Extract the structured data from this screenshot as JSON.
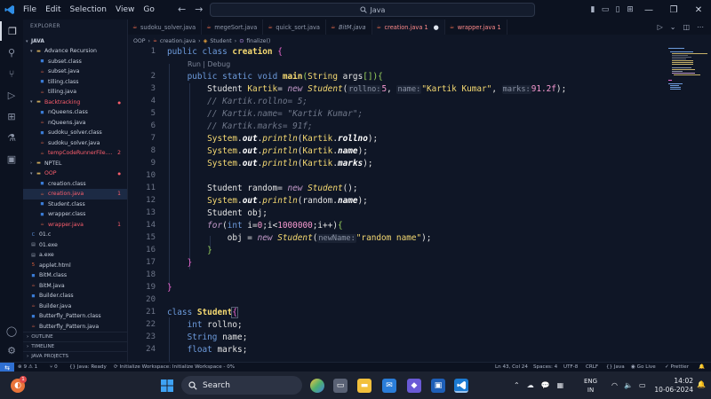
{
  "titlebar": {
    "menu": [
      "File",
      "Edit",
      "Selection",
      "View",
      "Go"
    ],
    "search": "Java"
  },
  "explorer": {
    "header": "EXPLORER",
    "root": "JAVA",
    "items": [
      {
        "label": "Advance Recursion",
        "type": "folder",
        "depth": 1,
        "open": true
      },
      {
        "label": "subset.class",
        "type": "class",
        "depth": 2
      },
      {
        "label": "subset.java",
        "type": "java",
        "depth": 2
      },
      {
        "label": "tilling.class",
        "type": "class",
        "depth": 2
      },
      {
        "label": "tilling.java",
        "type": "java",
        "depth": 2
      },
      {
        "label": "Backtracking",
        "type": "folder",
        "depth": 1,
        "open": true,
        "color": "#ff5f6d"
      },
      {
        "label": "nQueens.class",
        "type": "class",
        "depth": 2
      },
      {
        "label": "nQueens.java",
        "type": "java",
        "depth": 2
      },
      {
        "label": "sudoku_solver.class",
        "type": "class",
        "depth": 2
      },
      {
        "label": "sudoku_solver.java",
        "type": "java",
        "depth": 2
      },
      {
        "label": "tempCodeRunnerFile....",
        "type": "java",
        "depth": 2,
        "color": "#ff5f6d",
        "badge": "2"
      },
      {
        "label": "NPTEL",
        "type": "folder",
        "depth": 1,
        "open": false
      },
      {
        "label": "OOP",
        "type": "folder",
        "depth": 1,
        "open": true,
        "color": "#ff5f6d"
      },
      {
        "label": "creation.class",
        "type": "class",
        "depth": 2
      },
      {
        "label": "creation.java",
        "type": "java",
        "depth": 2,
        "color": "#ff5f6d",
        "badge": "1",
        "selected": true
      },
      {
        "label": "Student.class",
        "type": "class",
        "depth": 2
      },
      {
        "label": "wrapper.class",
        "type": "class",
        "depth": 2
      },
      {
        "label": "wrapper.java",
        "type": "java",
        "depth": 2,
        "color": "#ff5f6d",
        "badge": "1"
      },
      {
        "label": "01.c",
        "type": "c",
        "depth": 1
      },
      {
        "label": "01.exe",
        "type": "exe",
        "depth": 1
      },
      {
        "label": "a.exe",
        "type": "exe",
        "depth": 1
      },
      {
        "label": "applet.html",
        "type": "html",
        "depth": 1
      },
      {
        "label": "BitM.class",
        "type": "class",
        "depth": 1
      },
      {
        "label": "BitM.java",
        "type": "java",
        "depth": 1
      },
      {
        "label": "Builder.class",
        "type": "class",
        "depth": 1
      },
      {
        "label": "Builder.java",
        "type": "java",
        "depth": 1
      },
      {
        "label": "Butterfly_Pattern.class",
        "type": "class",
        "depth": 1
      },
      {
        "label": "Butterfly_Pattern.java",
        "type": "java",
        "depth": 1
      }
    ],
    "sections": [
      "OUTLINE",
      "TIMELINE",
      "JAVA PROJECTS"
    ]
  },
  "tabs": [
    {
      "label": "sudoku_solver.java",
      "active": false
    },
    {
      "label": "megeSort.java",
      "active": false
    },
    {
      "label": "quick_sort.java",
      "active": false
    },
    {
      "label": "BitM.java",
      "active": false
    },
    {
      "label": "creation.java 1",
      "active": true,
      "mark": "●"
    },
    {
      "label": "wrapper.java 1",
      "active": false,
      "color": "#ff8a8a"
    }
  ],
  "breadcrumb": [
    "OOP",
    "creation.java",
    "Student",
    "finalize()"
  ],
  "editor": {
    "codelens": "Run | Debug",
    "line_numbers": [
      "1",
      "2",
      "3",
      "4",
      "5",
      "6",
      "7",
      "8",
      "9",
      "10",
      "11",
      "12",
      "13",
      "14",
      "15",
      "16",
      "17",
      "18",
      "19",
      "20",
      "21",
      "22",
      "23",
      "24"
    ]
  },
  "status": {
    "errors": "9",
    "warnings": "1",
    "ports": "0",
    "java": "Java: Ready",
    "workspace": "Initialize Workspace: Initialize Workspace - 0%",
    "position": "Ln 43, Col 24",
    "spaces": "Spaces: 4",
    "encoding": "UTF-8",
    "eol": "CRLF",
    "language": "Java",
    "golive": "Go Live",
    "prettier": "Prettier"
  },
  "taskbar": {
    "search": "Search",
    "lang1": "ENG",
    "lang2": "IN",
    "time": "14:02",
    "date": "10-06-2024",
    "badge": "1"
  }
}
